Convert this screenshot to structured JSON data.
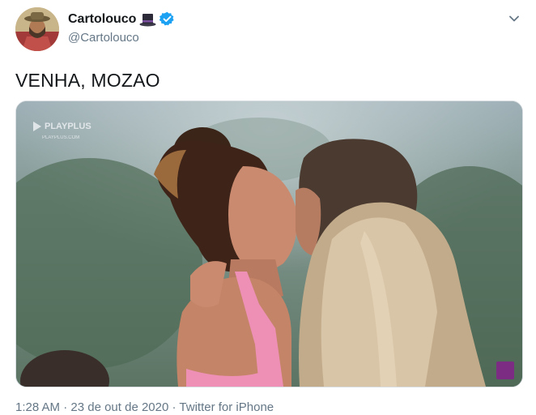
{
  "user": {
    "display_name": "Cartolouco",
    "handle": "@Cartolouco"
  },
  "tweet": {
    "text": "VENHA, MOZAO"
  },
  "media": {
    "logo_text": "PLAYPLUS",
    "logo_subtext": "PLAYPLUS.COM"
  },
  "meta": {
    "time": "1:28 AM",
    "separator": " · ",
    "date": "23 de out de 2020",
    "source": "Twitter for iPhone"
  },
  "colors": {
    "verified": "#1da1f2",
    "secondary_text": "#657786",
    "badge": "#7c2d83"
  }
}
